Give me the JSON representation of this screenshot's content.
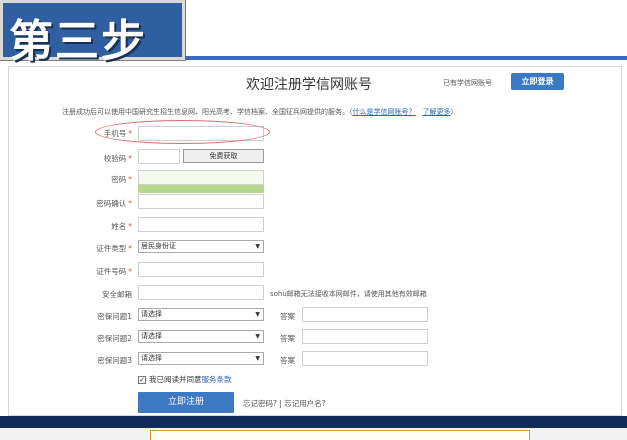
{
  "banner": {
    "step_text": "第三步"
  },
  "header": {
    "title": "欢迎注册学信网账号",
    "has_account_text": "已有学信网账号",
    "login_button": "立即登录"
  },
  "notice": {
    "text": "注册成功后可以使用中国研究生招生信息网、阳光高考、学信档案、全国征兵网提供的服务。",
    "link_what": "什么是学信网账号？",
    "link_more": "了解更多"
  },
  "form": {
    "phone_label": "手机号",
    "code_label": "校验码",
    "sms_button": "免费获取",
    "password_label": "密码",
    "password_confirm_label": "密码确认",
    "name_label": "姓名",
    "id_type_label": "证件类型",
    "id_type_value": "居民身份证",
    "id_number_label": "证件号码",
    "email_label": "安全邮箱",
    "email_hint": "sohu邮箱无法接收本网邮件，请使用其他有效邮箱",
    "q1_label": "密保问题1",
    "q2_label": "密保问题2",
    "q3_label": "密保问题3",
    "select_placeholder": "请选择",
    "answer_label": "答案",
    "required_mark": "*",
    "agree_text": "我已阅读并同意",
    "terms_link": "服务条款",
    "submit_button": "立即注册",
    "forgot_text": "忘记密码? | 忘记用户名?"
  },
  "icons": {
    "checkbox": "✓",
    "dropdown": "▼"
  },
  "colors": {
    "accent": "#3d78c2",
    "banner": "#2f5fa0",
    "highlight": "#e06a6a",
    "required": "#d9534f"
  }
}
